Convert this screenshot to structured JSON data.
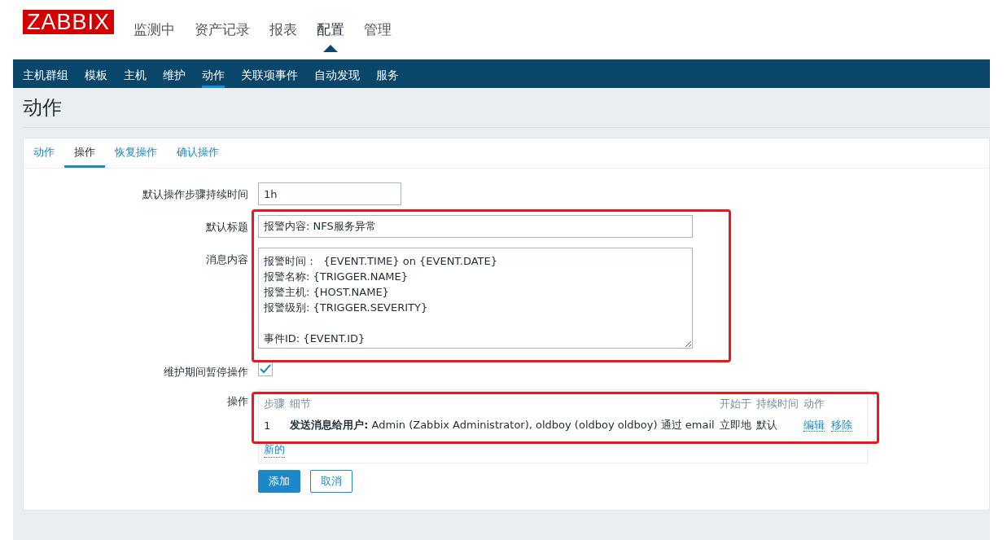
{
  "logo": "ZABBIX",
  "main_menu": [
    {
      "label": "监测中",
      "selected": false
    },
    {
      "label": "资产记录",
      "selected": false
    },
    {
      "label": "报表",
      "selected": false
    },
    {
      "label": "配置",
      "selected": true
    },
    {
      "label": "管理",
      "selected": false
    }
  ],
  "sub_menu": [
    {
      "label": "主机群组",
      "selected": false
    },
    {
      "label": "模板",
      "selected": false
    },
    {
      "label": "主机",
      "selected": false
    },
    {
      "label": "维护",
      "selected": false
    },
    {
      "label": "动作",
      "selected": true
    },
    {
      "label": "关联项事件",
      "selected": false
    },
    {
      "label": "自动发现",
      "selected": false
    },
    {
      "label": "服务",
      "selected": false
    }
  ],
  "page_title": "动作",
  "tabs": [
    {
      "label": "动作",
      "selected": false
    },
    {
      "label": "操作",
      "selected": true
    },
    {
      "label": "恢复操作",
      "selected": false
    },
    {
      "label": "确认操作",
      "selected": false
    }
  ],
  "form": {
    "step_duration": {
      "label": "默认操作步骤持续时间",
      "value": "1h"
    },
    "subject": {
      "label": "默认标题",
      "value": "报警内容: NFS服务异常"
    },
    "message": {
      "label": "消息内容",
      "value": "报警时间：  {EVENT.TIME} on {EVENT.DATE}\n报警名称: {TRIGGER.NAME}\n报警主机: {HOST.NAME}\n报警级别: {TRIGGER.SEVERITY}\n\n事件ID: {EVENT.ID}"
    },
    "pause_in_maintenance": {
      "label": "维护期间暂停操作",
      "checked": true
    },
    "operations": {
      "label": "操作",
      "columns": [
        "步骤",
        "细节",
        "开始于",
        "持续时间",
        "动作"
      ],
      "rows": [
        {
          "step": "1",
          "details": "**发送消息给用户:** Admin (Zabbix Administrator), oldboy (oldboy oldboy) 通过 email",
          "start": "立即地",
          "duration": "默认",
          "links": [
            "编辑",
            "移除"
          ]
        }
      ],
      "new_link": "新的"
    }
  },
  "buttons": [
    {
      "label": "添加",
      "kind": "primary"
    },
    {
      "label": "取消",
      "kind": "secondary"
    }
  ]
}
